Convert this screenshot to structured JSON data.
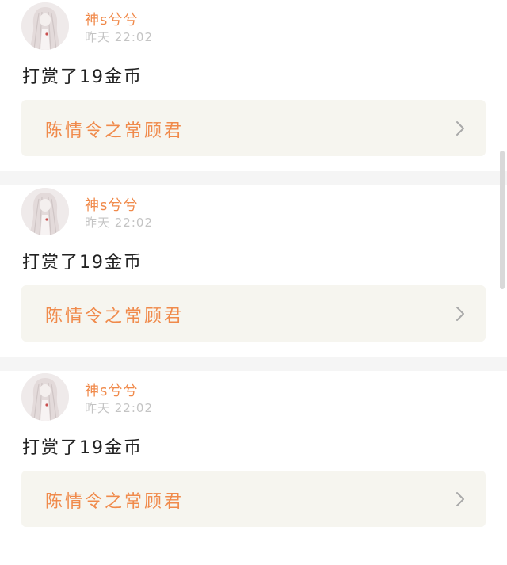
{
  "feed": {
    "items": [
      {
        "user": {
          "name": "神s兮兮",
          "avatar_icon": "avatar-long-hair-girl-icon"
        },
        "time": "昨天 22:02",
        "action": "打赏了19金币",
        "book": {
          "title": "陈情令之常顾君",
          "chevron_icon": "chevron-right-icon"
        }
      },
      {
        "user": {
          "name": "神s兮兮",
          "avatar_icon": "avatar-long-hair-girl-icon"
        },
        "time": "昨天 22:02",
        "action": "打赏了19金币",
        "book": {
          "title": "陈情令之常顾君",
          "chevron_icon": "chevron-right-icon"
        }
      },
      {
        "user": {
          "name": "神s兮兮",
          "avatar_icon": "avatar-long-hair-girl-icon"
        },
        "time": "昨天 22:02",
        "action": "打赏了19金币",
        "book": {
          "title": "陈情令之常顾君",
          "chevron_icon": "chevron-right-icon"
        }
      }
    ]
  },
  "colors": {
    "accent": "#f08a4b",
    "book_card_bg": "#f6f5ef",
    "divider": "#f5f5f5",
    "timestamp": "#c4c4c4"
  }
}
